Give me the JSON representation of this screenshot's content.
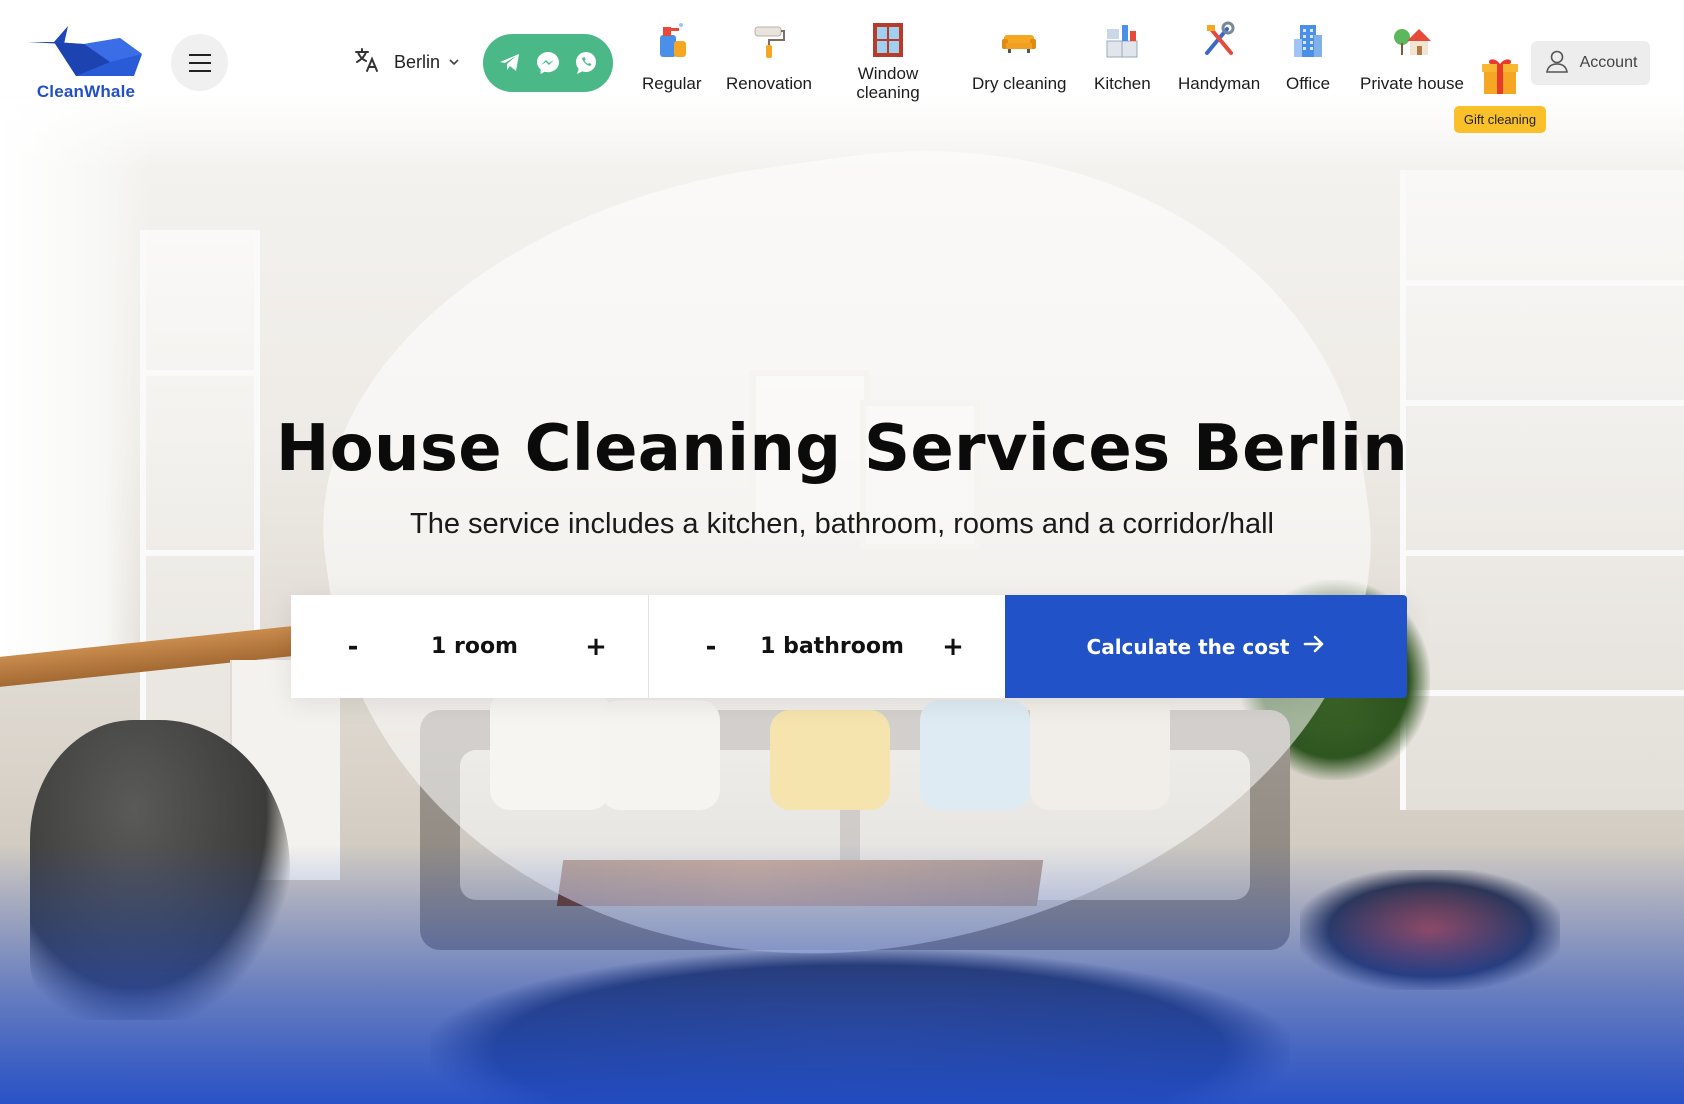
{
  "brand": {
    "name": "CleanWhale",
    "color": "#2350c9"
  },
  "header": {
    "menu_icon": "hamburger-icon",
    "city": {
      "icon": "translate-icon",
      "name": "Berlin",
      "chevron": "chevron-down-icon"
    },
    "messengers": {
      "color": "#4bb887",
      "items": [
        "telegram-icon",
        "messenger-icon",
        "whatsapp-icon"
      ]
    },
    "services": [
      {
        "label": "Regular",
        "icon": "spray-bottle-icon"
      },
      {
        "label": "Renovation",
        "icon": "paint-roller-icon"
      },
      {
        "label": "Window cleaning",
        "icon": "window-icon"
      },
      {
        "label": "Dry cleaning",
        "icon": "sofa-icon"
      },
      {
        "label": "Kitchen",
        "icon": "kitchen-icon"
      },
      {
        "label": "Handyman",
        "icon": "tools-icon"
      },
      {
        "label": "Office",
        "icon": "office-building-icon"
      },
      {
        "label": "Private house",
        "icon": "house-icon"
      }
    ],
    "gift": {
      "label": "Gift cleaning",
      "icon": "gift-box-icon",
      "badge_color": "#f9c02a"
    },
    "account": {
      "label": "Account",
      "icon": "user-icon"
    }
  },
  "hero": {
    "title": "House Cleaning Services Berlin",
    "subtitle": "The service includes a kitchen, bathroom, rooms and a corridor/hall"
  },
  "calculator": {
    "rooms": {
      "minus": "-",
      "value": "1 room",
      "plus": "+"
    },
    "bathrooms": {
      "minus": "-",
      "value": "1 bathroom",
      "plus": "+"
    },
    "button": {
      "label": "Calculate the cost",
      "icon": "arrow-right-icon",
      "color": "#2152c8"
    }
  }
}
